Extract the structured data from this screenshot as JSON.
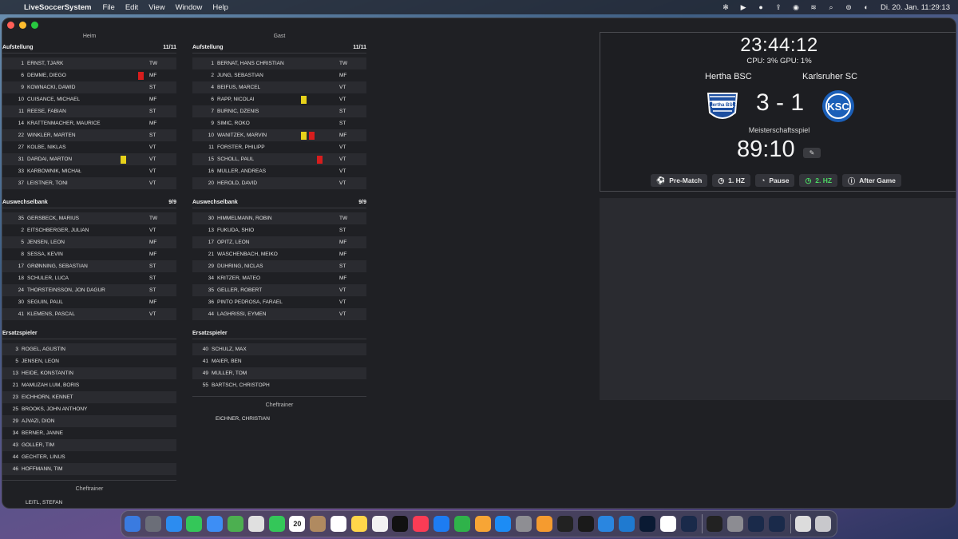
{
  "menubar": {
    "app_name": "LiveSoccerSystem",
    "menus": [
      "File",
      "Edit",
      "View",
      "Window",
      "Help"
    ],
    "clock": "Di. 20. Jan.  11:29:13",
    "status_icons": [
      "gear-icon",
      "play-icon",
      "person-icon",
      "upload-icon",
      "user-circle-icon",
      "wifi-icon",
      "search-icon",
      "control-center-icon",
      "siri-icon"
    ]
  },
  "home": {
    "column_title": "Heim",
    "lineup": {
      "title": "Aufstellung",
      "count": "11/11",
      "players": [
        {
          "num": "1",
          "name": "ERNST, TJARK",
          "pos": "TW",
          "cards": []
        },
        {
          "num": "6",
          "name": "DEMME, DIEGO",
          "pos": "MF",
          "cards": [
            "red"
          ]
        },
        {
          "num": "9",
          "name": "KOWNACKI, DAWID",
          "pos": "ST",
          "cards": []
        },
        {
          "num": "10",
          "name": "CUISANCE, MICHAËL",
          "pos": "MF",
          "cards": []
        },
        {
          "num": "11",
          "name": "REESE, FABIAN",
          "pos": "ST",
          "cards": []
        },
        {
          "num": "14",
          "name": "KRATTENMACHER, MAURICE",
          "pos": "MF",
          "cards": []
        },
        {
          "num": "22",
          "name": "WINKLER, MARTEN",
          "pos": "ST",
          "cards": []
        },
        {
          "num": "27",
          "name": "KOLBE, NIKLAS",
          "pos": "VT",
          "cards": []
        },
        {
          "num": "31",
          "name": "DÁRDAI, MÁRTON",
          "pos": "VT",
          "cards": [
            "yellow"
          ]
        },
        {
          "num": "33",
          "name": "KARBOWNIK, MICHAŁ",
          "pos": "VT",
          "cards": []
        },
        {
          "num": "37",
          "name": "LEISTNER, TONI",
          "pos": "VT",
          "cards": []
        }
      ]
    },
    "bench": {
      "title": "Auswechselbank",
      "count": "9/9",
      "players": [
        {
          "num": "35",
          "name": "GERSBECK, MARIUS",
          "pos": "TW"
        },
        {
          "num": "2",
          "name": "EITSCHBERGER, JULIAN",
          "pos": "VT"
        },
        {
          "num": "5",
          "name": "JENSEN, LEON",
          "pos": "MF"
        },
        {
          "num": "8",
          "name": "SESSA, KEVIN",
          "pos": "MF"
        },
        {
          "num": "17",
          "name": "GRØNNING, SEBASTIAN",
          "pos": "ST"
        },
        {
          "num": "18",
          "name": "SCHULER, LUCA",
          "pos": "ST"
        },
        {
          "num": "24",
          "name": "THORSTEINSSON, JÓN DAGUR",
          "pos": "ST"
        },
        {
          "num": "30",
          "name": "SEGUIN, PAUL",
          "pos": "MF"
        },
        {
          "num": "41",
          "name": "KLEMENS, PASCAL",
          "pos": "VT"
        }
      ]
    },
    "reserves": {
      "title": "Ersatzspieler",
      "players": [
        {
          "num": "3",
          "name": "ROGEL, AGUSTÍN"
        },
        {
          "num": "5",
          "name": "JENSEN, LEON"
        },
        {
          "num": "13",
          "name": "HEIDE, KONSTANTIN"
        },
        {
          "num": "21",
          "name": "MAMUZAH LUM, BORIS"
        },
        {
          "num": "23",
          "name": "EICHHORN, KENNET"
        },
        {
          "num": "25",
          "name": "BROOKS, JOHN ANTHONY"
        },
        {
          "num": "29",
          "name": "AJVAZI, DION"
        },
        {
          "num": "34",
          "name": "BERNER, JANNE"
        },
        {
          "num": "43",
          "name": "GOLLER, TIM"
        },
        {
          "num": "44",
          "name": "GECHTER, LINUS"
        },
        {
          "num": "46",
          "name": "HOFFMANN, TIM"
        }
      ]
    },
    "coach": {
      "title": "Cheftrainer",
      "name": "LEITL, STEFAN"
    }
  },
  "away": {
    "column_title": "Gast",
    "lineup": {
      "title": "Aufstellung",
      "count": "11/11",
      "players": [
        {
          "num": "1",
          "name": "BERNAT, HANS CHRISTIAN",
          "pos": "TW",
          "cards": []
        },
        {
          "num": "2",
          "name": "JUNG, SEBASTIAN",
          "pos": "MF",
          "cards": []
        },
        {
          "num": "4",
          "name": "BEIFUS, MARCEL",
          "pos": "VT",
          "cards": []
        },
        {
          "num": "6",
          "name": "RAPP, NICOLAI",
          "pos": "VT",
          "cards": [
            "yellow"
          ]
        },
        {
          "num": "7",
          "name": "BURNIĆ, DŽENIS",
          "pos": "ST",
          "cards": []
        },
        {
          "num": "9",
          "name": "ŠIMIĆ, ROKO",
          "pos": "ST",
          "cards": []
        },
        {
          "num": "10",
          "name": "WANITZEK, MARVIN",
          "pos": "MF",
          "cards": [
            "yellow",
            "red"
          ]
        },
        {
          "num": "11",
          "name": "FÖRSTER, PHILIPP",
          "pos": "VT",
          "cards": []
        },
        {
          "num": "15",
          "name": "SCHOLL, PAUL",
          "pos": "VT",
          "cards": [
            "red"
          ]
        },
        {
          "num": "16",
          "name": "MÜLLER, ANDREAS",
          "pos": "VT",
          "cards": []
        },
        {
          "num": "20",
          "name": "HEROLD, DAVID",
          "pos": "VT",
          "cards": []
        }
      ]
    },
    "bench": {
      "title": "Auswechselbank",
      "count": "9/9",
      "players": [
        {
          "num": "30",
          "name": "HIMMELMANN, ROBIN",
          "pos": "TW"
        },
        {
          "num": "13",
          "name": "FUKUDA, SHIO",
          "pos": "ST"
        },
        {
          "num": "17",
          "name": "OPITZ, LEON",
          "pos": "MF"
        },
        {
          "num": "21",
          "name": "WÄSCHENBACH, MEIKO",
          "pos": "MF"
        },
        {
          "num": "29",
          "name": "DÜHRING, NICLAS",
          "pos": "ST"
        },
        {
          "num": "34",
          "name": "KRITZER, MATEO",
          "pos": "MF"
        },
        {
          "num": "35",
          "name": "GELLER, ROBERT",
          "pos": "VT"
        },
        {
          "num": "36",
          "name": "PINTO PEDROSA, FARAEL",
          "pos": "VT"
        },
        {
          "num": "44",
          "name": "LAGHRISSI, EYMEN",
          "pos": "VT"
        }
      ]
    },
    "reserves": {
      "title": "Ersatzspieler",
      "players": [
        {
          "num": "40",
          "name": "SCHULZ, MAX"
        },
        {
          "num": "41",
          "name": "MAIER, BEN"
        },
        {
          "num": "49",
          "name": "MÜLLER, TOM"
        },
        {
          "num": "55",
          "name": "BARTSCH, CHRISTOPH"
        }
      ]
    },
    "coach": {
      "title": "Cheftrainer",
      "name": "EICHNER, CHRISTIAN"
    }
  },
  "scoreboard": {
    "clock": "23:44:12",
    "perf": "CPU: 3%  GPU: 1%",
    "home_team": "Hertha BSC",
    "away_team": "Karlsruher SC",
    "home_crest_text": "Hertha BSC",
    "away_crest_text": "KSC",
    "score": "3 - 1",
    "competition": "Meisterschaftsspiel",
    "match_time": "89:10",
    "phases": [
      {
        "label": "Pre-Match",
        "icon": "soccer-ball-icon",
        "active": false
      },
      {
        "label": "1. HZ",
        "icon": "clock-icon",
        "active": false
      },
      {
        "label": "Pause",
        "icon": "timer-icon",
        "active": false
      },
      {
        "label": "2. HZ",
        "icon": "clock-icon",
        "active": true
      },
      {
        "label": "After Game",
        "icon": "info-icon",
        "active": false
      }
    ],
    "colors": {
      "active_phase": "#4cd964",
      "yellow_card": "#e7d21a",
      "red_card": "#d71d1d",
      "hertha_blue": "#1d4fa0",
      "ksc_blue": "#1b5fb8"
    }
  },
  "dock": {
    "apps": [
      "finder-icon",
      "launchpad-icon",
      "safari-icon",
      "messages-icon",
      "mail-icon",
      "maps-icon",
      "photos-icon",
      "facetime-icon",
      "calendar-icon",
      "contacts-icon",
      "reminders-icon",
      "notes-icon",
      "freeform-icon",
      "tv-icon",
      "music-icon",
      "keynote-icon",
      "numbers-icon",
      "pages-icon",
      "app-store-icon",
      "system-settings-icon",
      "home-icon",
      "capcut-icon",
      "affinity-icon",
      "xcode-icon",
      "vscode-icon",
      "photoshop-icon",
      "chrome-icon",
      "soccer-app-icon",
      "activity-monitor-icon",
      "disk-utility-icon",
      "soccer-app-2-icon",
      "soccer-app-3-icon",
      "downloads-icon",
      "trash-icon"
    ],
    "calendar_day": "20"
  }
}
